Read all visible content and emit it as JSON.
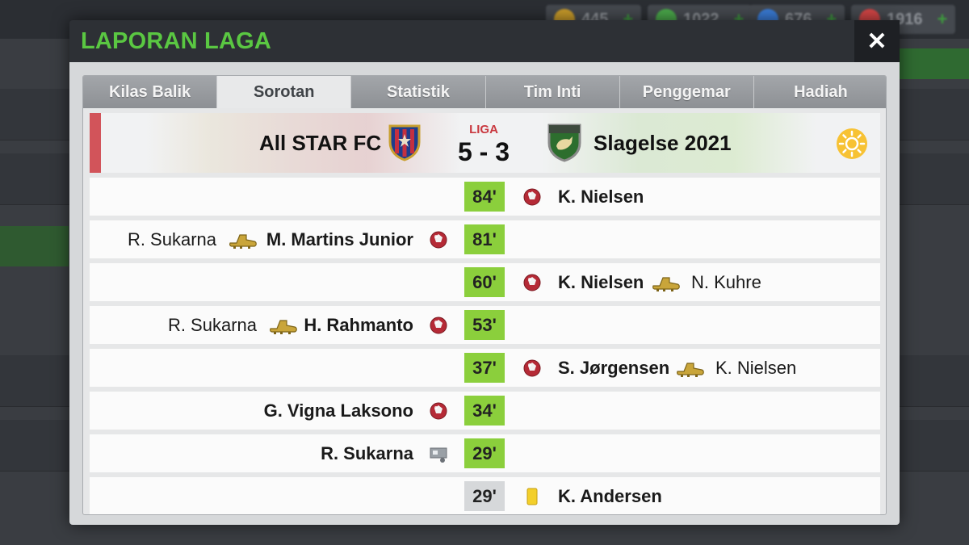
{
  "background": {
    "resources": [
      {
        "icon": "coin-icon",
        "value": "445",
        "color": "#c79a2a"
      },
      {
        "icon": "cash-icon",
        "value": "1022",
        "color": "#4aa84a"
      },
      {
        "icon": "tactics-icon",
        "value": "676",
        "color": "#3a7bd5"
      },
      {
        "icon": "medical-icon",
        "value": "1916",
        "color": "#d24545"
      }
    ]
  },
  "modal": {
    "title": "LAPORAN LAGA",
    "close_label": "✕"
  },
  "tabs": [
    {
      "label": "Kilas Balik",
      "active": false
    },
    {
      "label": "Sorotan",
      "active": true
    },
    {
      "label": "Statistik",
      "active": false
    },
    {
      "label": "Tim Inti",
      "active": false
    },
    {
      "label": "Penggemar",
      "active": false
    },
    {
      "label": "Hadiah",
      "active": false
    }
  ],
  "match": {
    "home_team": "All STAR FC",
    "away_team": "Slagelse 2021",
    "competition": "LIGA",
    "score": "5 - 3",
    "weather_icon": "sun-icon"
  },
  "events": [
    {
      "minute": "84'",
      "side": "away",
      "type": "goal",
      "player": "K. Nielsen",
      "assist": ""
    },
    {
      "minute": "81'",
      "side": "home",
      "type": "goal",
      "player": "M. Martins Junior",
      "assist": "R. Sukarna"
    },
    {
      "minute": "60'",
      "side": "away",
      "type": "goal",
      "player": "K. Nielsen",
      "assist": "N. Kuhre"
    },
    {
      "minute": "53'",
      "side": "home",
      "type": "goal",
      "player": "H. Rahmanto",
      "assist": "R. Sukarna"
    },
    {
      "minute": "37'",
      "side": "away",
      "type": "goal",
      "player": "S. Jørgensen",
      "assist": "K. Nielsen"
    },
    {
      "minute": "34'",
      "side": "home",
      "type": "goal",
      "player": "G. Vigna Laksono",
      "assist": ""
    },
    {
      "minute": "29'",
      "side": "home",
      "type": "penalty",
      "player": "R. Sukarna",
      "assist": ""
    },
    {
      "minute": "29'",
      "side": "away",
      "type": "yellow-card",
      "player": "K. Andersen",
      "assist": ""
    }
  ],
  "colors": {
    "title_green": "#5ac742",
    "minute_green": "#8bcf3c",
    "minute_grey": "#d6d8da",
    "home_accent": "#d2545a"
  }
}
